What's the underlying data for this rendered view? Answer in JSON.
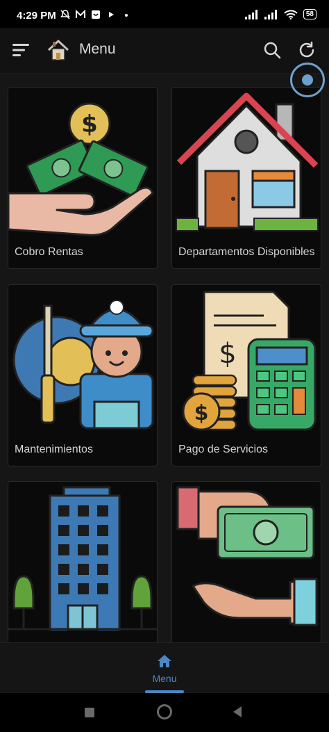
{
  "status_bar": {
    "time": "4:29 PM",
    "battery": "58",
    "icons": [
      "muted-notification-icon",
      "mail-icon",
      "app-icon",
      "play-icon",
      "dot-icon",
      "signal-icon",
      "signal-icon",
      "wifi-icon",
      "battery-icon"
    ]
  },
  "app_bar": {
    "title": "Menu",
    "icons": [
      "hamburger-menu-icon",
      "home-icon",
      "search-icon",
      "refresh-icon"
    ]
  },
  "menu": {
    "items": [
      {
        "label": "Cobro Rentas",
        "icon": "money-in-hand-icon"
      },
      {
        "label": "Departamentos Disponibles",
        "icon": "house-icon"
      },
      {
        "label": "Mantenimientos",
        "icon": "maintenance-worker-icon"
      },
      {
        "label": "Pago de Servicios",
        "icon": "bill-calculator-icon"
      },
      {
        "label": "",
        "icon": "building-icon"
      },
      {
        "label": "",
        "icon": "payment-hands-icon"
      }
    ]
  },
  "bottom_nav": {
    "label": "Menu",
    "icon": "home-icon"
  },
  "colors": {
    "accent": "#4a88c4",
    "background": "#161616",
    "card": "#0a0a0a"
  }
}
